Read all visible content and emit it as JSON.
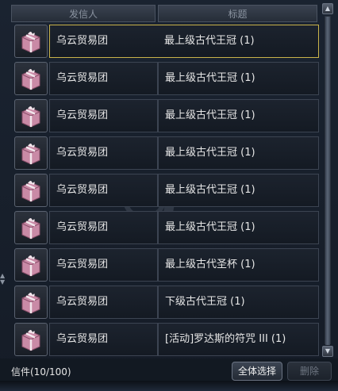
{
  "headers": {
    "sender": "发信人",
    "subject": "标题"
  },
  "mails": [
    {
      "sender": "乌云贸易团",
      "subject": "最上级古代王冠 (1)",
      "icon": "gift-box-icon"
    },
    {
      "sender": "乌云贸易团",
      "subject": "最上级古代王冠 (1)",
      "icon": "gift-box-icon"
    },
    {
      "sender": "乌云贸易团",
      "subject": "最上级古代王冠 (1)",
      "icon": "gift-box-icon"
    },
    {
      "sender": "乌云贸易团",
      "subject": "最上级古代王冠 (1)",
      "icon": "gift-box-icon"
    },
    {
      "sender": "乌云贸易团",
      "subject": "最上级古代王冠 (1)",
      "icon": "gift-box-icon"
    },
    {
      "sender": "乌云贸易团",
      "subject": "最上级古代王冠 (1)",
      "icon": "gift-box-icon"
    },
    {
      "sender": "乌云贸易团",
      "subject": "最上级古代圣杯 (1)",
      "icon": "gift-box-icon"
    },
    {
      "sender": "乌云贸易团",
      "subject": "下级古代王冠 (1)",
      "icon": "gift-box-icon"
    },
    {
      "sender": "乌云贸易团",
      "subject": "[活动]罗达斯的符咒 III (1)",
      "icon": "gift-box-icon"
    }
  ],
  "selected_index": 0,
  "footer": {
    "count": "信件(10/100)",
    "select_all_label": "全体选择",
    "delete_label": "删除"
  },
  "colors": {
    "selected_border": "#c9b34a",
    "gift_pink": "#c98aa6",
    "text": "#e6e6e6"
  }
}
